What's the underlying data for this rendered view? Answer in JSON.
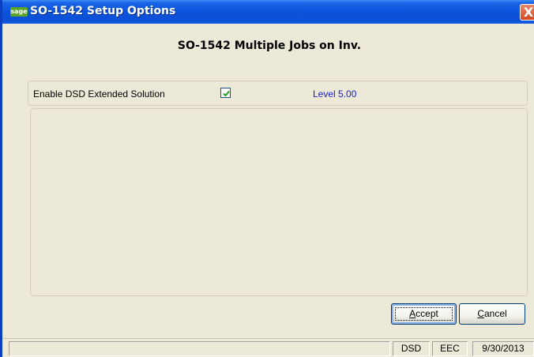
{
  "window": {
    "app_logo": "sage",
    "title": "SO-1542 Setup Options",
    "close_glyph": "X"
  },
  "heading": "SO-1542 Multiple Jobs on Inv.",
  "option": {
    "label": "Enable DSD Extended Solution",
    "checked": true,
    "level": "Level  5.00"
  },
  "buttons": {
    "accept_accel": "A",
    "accept_rest": "ccept",
    "cancel_accel": "C",
    "cancel_rest": "ancel"
  },
  "statusbar": {
    "cells": [
      "",
      "DSD",
      "EEC",
      "9/30/2013"
    ]
  },
  "colors": {
    "titlebar": "#0b4fd4",
    "window_bg": "#ece9d8",
    "level_text": "#1a1acc",
    "close_button": "#d6461c",
    "checkmark": "#21a121"
  },
  "icons": {
    "app_logo": "sage-logo-icon",
    "close": "close-icon",
    "checkbox_check": "checkmark-icon"
  }
}
